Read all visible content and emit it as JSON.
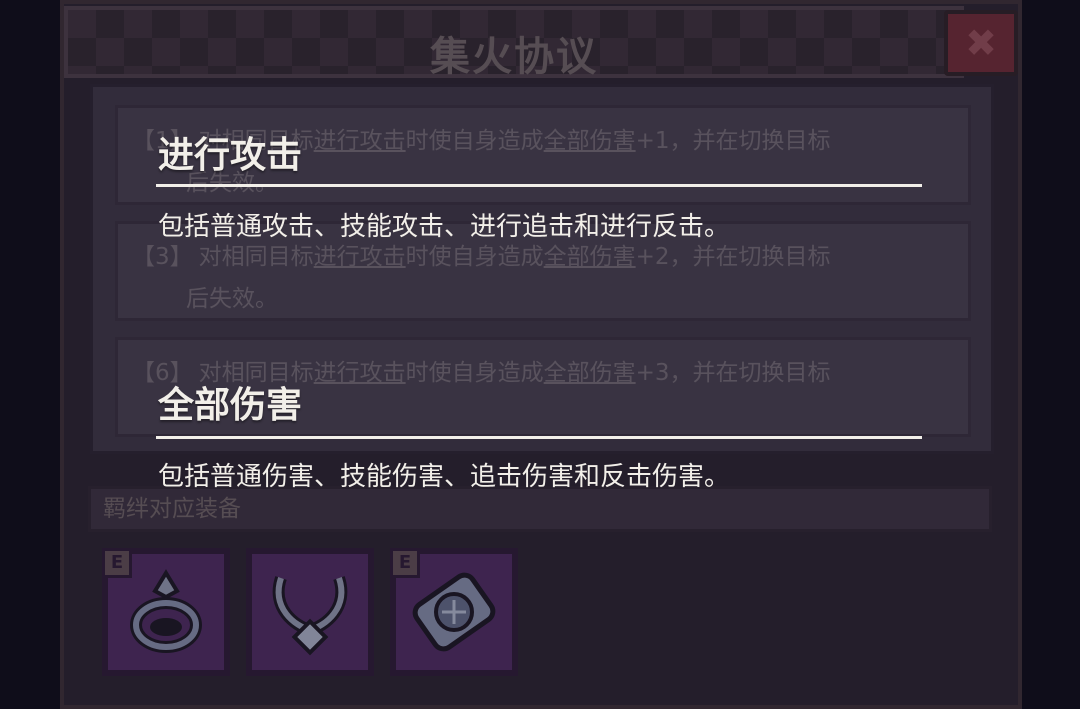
{
  "dialog": {
    "title": "集火协议",
    "close_glyph": "✖"
  },
  "effects": [
    {
      "tier": "【1】",
      "prefix": "对相同目标",
      "link1": "进行攻击",
      "mid": "时使自身造成",
      "link2": "全部伤害",
      "suffix": "+1，并在切换目标",
      "tail": "后失效。"
    },
    {
      "tier": "【3】",
      "prefix": "对相同目标",
      "link1": "进行攻击",
      "mid": "时使自身造成",
      "link2": "全部伤害",
      "suffix": "+2，并在切换目标",
      "tail": "后失效。"
    },
    {
      "tier": "【6】",
      "prefix": "对相同目标",
      "link1": "进行攻击",
      "mid": "时使自身造成",
      "link2": "全部伤害",
      "suffix": "+3，并在切换目标",
      "tail": ""
    }
  ],
  "equipment_section": {
    "label": "羁绊对应装备"
  },
  "equipment": [
    {
      "icon": "ring-icon",
      "badge": "E"
    },
    {
      "icon": "necklace-icon",
      "badge": ""
    },
    {
      "icon": "armor-icon",
      "badge": "E"
    }
  ],
  "glossary": [
    {
      "term": "进行攻击",
      "desc": "包括普通攻击、技能攻击、进行追击和进行反击。"
    },
    {
      "term": "全部伤害",
      "desc": "包括普通伤害、技能伤害、追击伤害和反击伤害。"
    }
  ],
  "colors": {
    "panel": "#2a2230",
    "slot": "#4b2a5e",
    "close": "#6a2a36",
    "popup_text": "#f2efe9"
  }
}
